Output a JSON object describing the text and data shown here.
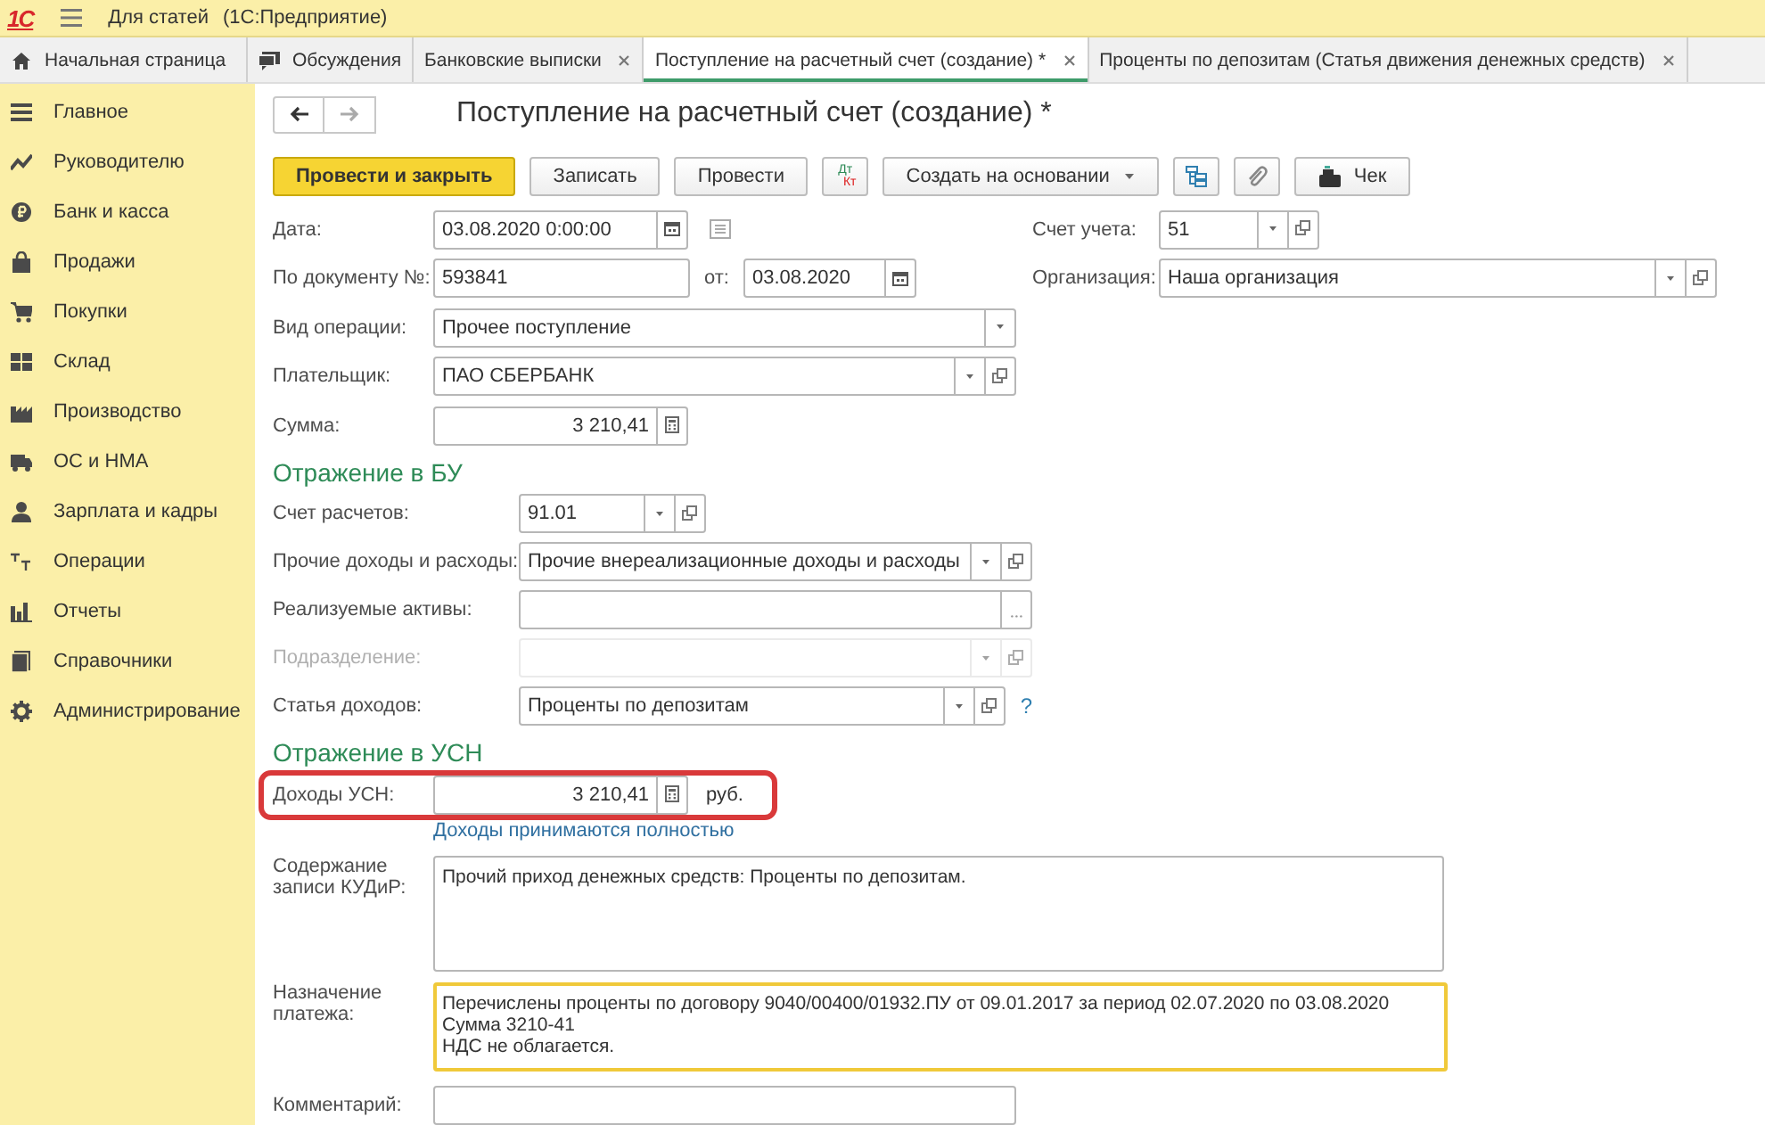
{
  "app_bar": {
    "logo": "1С",
    "title": "Для статей",
    "subtitle": "(1С:Предприятие)"
  },
  "tabs": [
    {
      "label": "Начальная страница",
      "selected": false,
      "closable": false
    },
    {
      "label": "Обсуждения",
      "selected": false,
      "closable": false
    },
    {
      "label": "Банковские выписки",
      "selected": false,
      "closable": true
    },
    {
      "label": "Поступление на расчетный счет (создание) *",
      "selected": true,
      "closable": true
    },
    {
      "label": "Проценты по депозитам (Статья движения денежных средств)",
      "selected": false,
      "closable": true
    }
  ],
  "sidebar": {
    "items": [
      {
        "label": "Главное"
      },
      {
        "label": "Руководителю"
      },
      {
        "label": "Банк и касса"
      },
      {
        "label": "Продажи"
      },
      {
        "label": "Покупки"
      },
      {
        "label": "Склад"
      },
      {
        "label": "Производство"
      },
      {
        "label": "ОС и НМА"
      },
      {
        "label": "Зарплата и кадры"
      },
      {
        "label": "Операции"
      },
      {
        "label": "Отчеты"
      },
      {
        "label": "Справочники"
      },
      {
        "label": "Администрирование"
      }
    ]
  },
  "form": {
    "title": "Поступление на расчетный счет (создание) *",
    "nav": {
      "back_disabled": false,
      "forward_disabled": true
    },
    "toolbar": [
      {
        "kind": "primary",
        "label": "Провести и закрыть"
      },
      {
        "kind": "button",
        "label": "Записать"
      },
      {
        "kind": "button",
        "label": "Провести"
      },
      {
        "kind": "dtkt",
        "top": "Дт",
        "bottom": "Кт"
      },
      {
        "kind": "menu",
        "label": "Создать на основании"
      },
      {
        "kind": "structure"
      },
      {
        "kind": "clip"
      },
      {
        "kind": "receipt",
        "label": "Чек"
      }
    ],
    "sections": [
      {
        "rows": [
          {
            "label": "Дата:",
            "fields": [
              {
                "kind": "text",
                "value": "03.08.2020  0:00:00",
                "buttons": [
                  {
                    "kind": "calendar"
                  }
                ]
              }
            ],
            "note_icon": true,
            "right": {
              "label": "Счет учета:",
              "value": "51",
              "buttons": [
                {
                  "kind": "dropdown"
                },
                {
                  "kind": "open"
                }
              ]
            }
          },
          {
            "label": "По документу №:",
            "fields": [
              {
                "kind": "text",
                "value": "593841"
              },
              {
                "kind": "text",
                "prefix": "от:",
                "value": "03.08.2020",
                "buttons": [
                  {
                    "kind": "calendar"
                  }
                ]
              }
            ],
            "right": {
              "label": "Организация:",
              "value": "Наша организация",
              "buttons": [
                {
                  "kind": "dropdown"
                },
                {
                  "kind": "open"
                }
              ]
            }
          },
          {
            "label": "Вид операции:",
            "fields": [
              {
                "kind": "text",
                "value": "Прочее поступление",
                "buttons": [
                  {
                    "kind": "dropdown"
                  }
                ]
              }
            ]
          },
          {
            "label": "Плательщик:",
            "fields": [
              {
                "kind": "text",
                "value": "ПАО СБЕРБАНК",
                "buttons": [
                  {
                    "kind": "dropdown"
                  },
                  {
                    "kind": "open"
                  }
                ]
              }
            ]
          },
          {
            "label": "Сумма:",
            "fields": [
              {
                "kind": "number",
                "value": "3 210,41",
                "buttons": [
                  {
                    "kind": "calculator"
                  }
                ]
              }
            ]
          }
        ]
      },
      {
        "title": "Отражение в БУ",
        "rows": [
          {
            "label": "Счет расчетов:",
            "fields": [
              {
                "kind": "text",
                "value": "91.01",
                "buttons": [
                  {
                    "kind": "dropdown"
                  },
                  {
                    "kind": "open"
                  }
                ]
              }
            ]
          },
          {
            "label": "Прочие доходы и расходы:",
            "fields": [
              {
                "kind": "text",
                "value": "Прочие внереализационные доходы и расходы",
                "buttons": [
                  {
                    "kind": "dropdown"
                  },
                  {
                    "kind": "open"
                  }
                ]
              }
            ]
          },
          {
            "label": "Реализуемые активы:",
            "fields": [
              {
                "kind": "text",
                "buttons": [
                  {
                    "kind": "select"
                  }
                ]
              }
            ]
          },
          {
            "label": "Подразделение:",
            "disabled": true,
            "fields": [
              {
                "kind": "text",
                "buttons": [
                  {
                    "kind": "dropdown"
                  },
                  {
                    "kind": "open"
                  }
                ]
              }
            ]
          },
          {
            "label": "Статья доходов:",
            "fields": [
              {
                "kind": "text",
                "value": "Проценты по депозитам",
                "buttons": [
                  {
                    "kind": "dropdown"
                  },
                  {
                    "kind": "open"
                  }
                ]
              }
            ],
            "help": "?"
          }
        ]
      },
      {
        "title": "Отражение в УСН",
        "rows": [
          {
            "label": "Доходы УСН:",
            "highlighted": true,
            "fields": [
              {
                "kind": "number",
                "value": "3 210,41",
                "buttons": [
                  {
                    "kind": "calculator"
                  }
                ],
                "unit": "руб."
              }
            ]
          },
          {
            "kind": "link",
            "text": "Доходы принимаются полностью"
          },
          {
            "kind": "textarea",
            "label": "Содержание записи КУДиР:",
            "value": "Прочий приход денежных средств: Проценты по депозитам.",
            "focused": false
          },
          {
            "kind": "textarea",
            "label": "Назначение платежа:",
            "value": "Перечислены проценты по договору 9040/00400/01932.ПУ от 09.01.2017 за период 02.07.2020 по 03.08.2020\nСумма 3210-41\nНДС не облагается.",
            "focused": true
          },
          {
            "label": "Комментарий:",
            "fields": [
              {
                "kind": "text"
              }
            ]
          }
        ]
      }
    ]
  }
}
